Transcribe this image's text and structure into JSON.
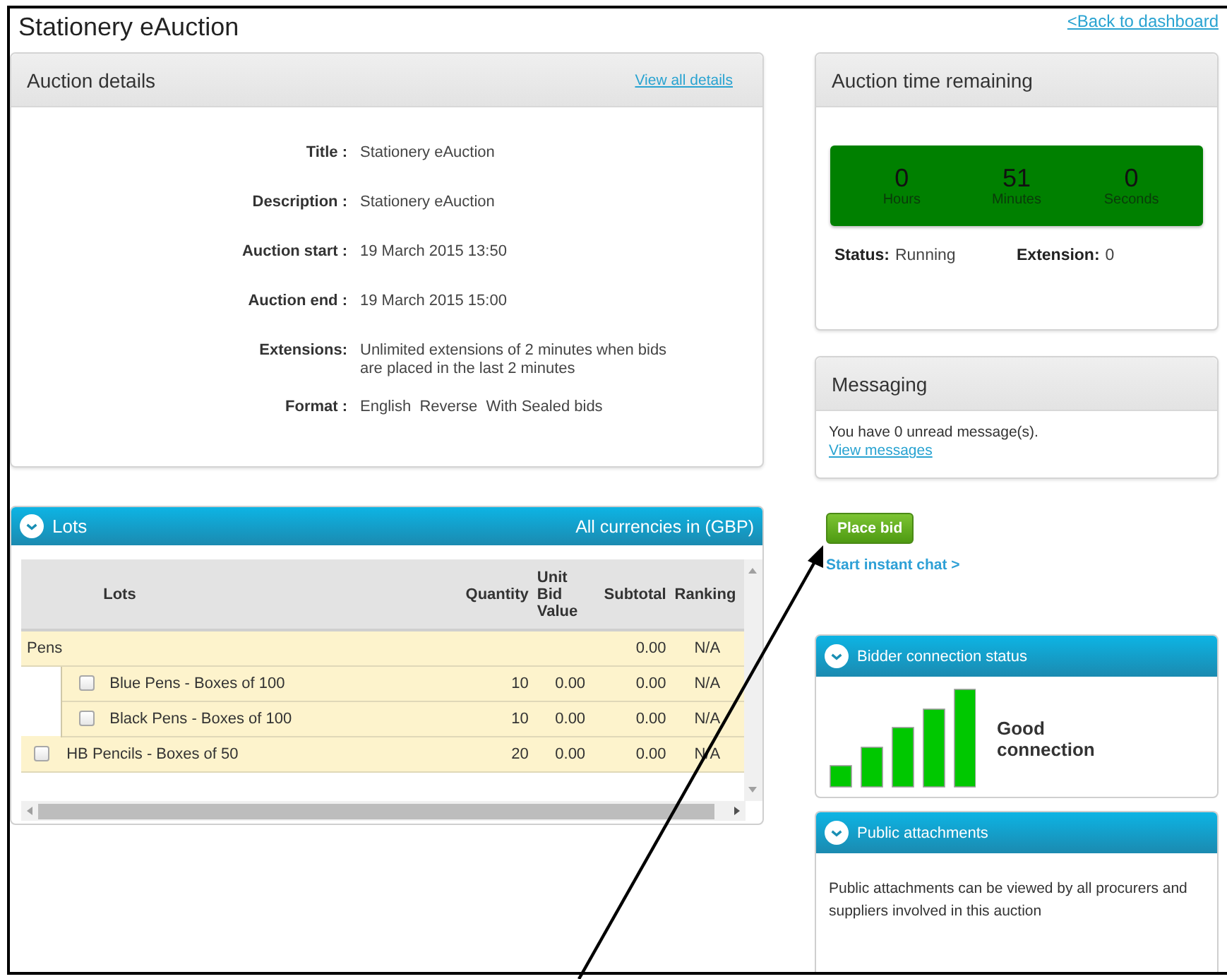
{
  "page": {
    "title": "Stationery eAuction",
    "back_link": "<Back to dashboard"
  },
  "auction_details": {
    "title": "Auction details",
    "link": "View all details",
    "fields": [
      {
        "label": "Title :",
        "value": "Stationery eAuction"
      },
      {
        "label": "Description :",
        "value": "Stationery eAuction"
      },
      {
        "label": "Auction start :",
        "value": "19 March 2015 13:50"
      },
      {
        "label": "Auction end :",
        "value": "19 March 2015 15:00"
      },
      {
        "label": "Extensions:",
        "value": "Unlimited extensions of 2 minutes when bids are placed in the last 2 minutes"
      },
      {
        "label": "Format :",
        "value": "English  Reverse  With Sealed bids"
      }
    ]
  },
  "lots": {
    "title": "Lots",
    "currency_note": "All currencies in (GBP)",
    "columns": [
      "Lots",
      "Quantity",
      "Unit Bid Value",
      "Subtotal",
      "Ranking"
    ],
    "rows": [
      {
        "kind": "group",
        "lot": "Pens",
        "subtotal": "0.00",
        "ranking": "N/A",
        "children": [
          {
            "kind": "item",
            "checked": false,
            "lot": "Blue Pens - Boxes of 100",
            "quantity": "10",
            "unit_bid_value": "0.00",
            "subtotal": "0.00",
            "ranking": "N/A"
          },
          {
            "kind": "item",
            "checked": false,
            "lot": "Black Pens - Boxes of 100",
            "quantity": "10",
            "unit_bid_value": "0.00",
            "subtotal": "0.00",
            "ranking": "N/A"
          }
        ]
      },
      {
        "kind": "item",
        "checked": false,
        "lot": "HB Pencils - Boxes of 50",
        "quantity": "20",
        "unit_bid_value": "0.00",
        "subtotal": "0.00",
        "ranking": "N/A"
      }
    ]
  },
  "time_remaining": {
    "title": "Auction time remaining",
    "units": [
      {
        "value": "0",
        "label": "Hours"
      },
      {
        "value": "51",
        "label": "Minutes"
      },
      {
        "value": "0",
        "label": "Seconds"
      }
    ],
    "status_label": "Status:",
    "status": "Running",
    "extension_label": "Extension:",
    "extension": "0"
  },
  "messaging": {
    "title": "Messaging",
    "text": "You have 0 unread message(s).",
    "link": "View messages"
  },
  "actions": {
    "place_bid": "Place bid",
    "chat_link": "Start instant chat >"
  },
  "connection": {
    "title": "Bidder connection status",
    "text": "Good connection"
  },
  "attachments": {
    "title": "Public attachments",
    "text": "Public attachments can be viewed by all procurers and suppliers involved in this auction"
  }
}
